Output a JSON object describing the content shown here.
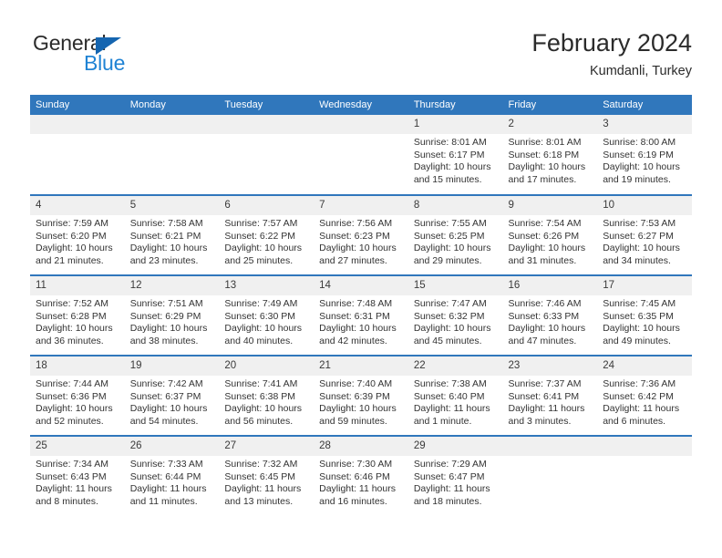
{
  "logo": {
    "text_top": "General",
    "text_bottom": "Blue",
    "triangle_color": "#1565b0",
    "blue_color": "#2083d4"
  },
  "header": {
    "title": "February 2024",
    "subtitle": "Kumdanli, Turkey"
  },
  "theme": {
    "header_blue": "#3077bc",
    "day_band_gray": "#f0f0f0",
    "text_dark": "#2b2b2b"
  },
  "calendar": {
    "weekday_headers": [
      "Sunday",
      "Monday",
      "Tuesday",
      "Wednesday",
      "Thursday",
      "Friday",
      "Saturday"
    ],
    "weeks": [
      [
        {
          "day": "",
          "sunrise": "",
          "sunset": "",
          "daylight": ""
        },
        {
          "day": "",
          "sunrise": "",
          "sunset": "",
          "daylight": ""
        },
        {
          "day": "",
          "sunrise": "",
          "sunset": "",
          "daylight": ""
        },
        {
          "day": "",
          "sunrise": "",
          "sunset": "",
          "daylight": ""
        },
        {
          "day": "1",
          "sunrise": "Sunrise: 8:01 AM",
          "sunset": "Sunset: 6:17 PM",
          "daylight": "Daylight: 10 hours and 15 minutes."
        },
        {
          "day": "2",
          "sunrise": "Sunrise: 8:01 AM",
          "sunset": "Sunset: 6:18 PM",
          "daylight": "Daylight: 10 hours and 17 minutes."
        },
        {
          "day": "3",
          "sunrise": "Sunrise: 8:00 AM",
          "sunset": "Sunset: 6:19 PM",
          "daylight": "Daylight: 10 hours and 19 minutes."
        }
      ],
      [
        {
          "day": "4",
          "sunrise": "Sunrise: 7:59 AM",
          "sunset": "Sunset: 6:20 PM",
          "daylight": "Daylight: 10 hours and 21 minutes."
        },
        {
          "day": "5",
          "sunrise": "Sunrise: 7:58 AM",
          "sunset": "Sunset: 6:21 PM",
          "daylight": "Daylight: 10 hours and 23 minutes."
        },
        {
          "day": "6",
          "sunrise": "Sunrise: 7:57 AM",
          "sunset": "Sunset: 6:22 PM",
          "daylight": "Daylight: 10 hours and 25 minutes."
        },
        {
          "day": "7",
          "sunrise": "Sunrise: 7:56 AM",
          "sunset": "Sunset: 6:23 PM",
          "daylight": "Daylight: 10 hours and 27 minutes."
        },
        {
          "day": "8",
          "sunrise": "Sunrise: 7:55 AM",
          "sunset": "Sunset: 6:25 PM",
          "daylight": "Daylight: 10 hours and 29 minutes."
        },
        {
          "day": "9",
          "sunrise": "Sunrise: 7:54 AM",
          "sunset": "Sunset: 6:26 PM",
          "daylight": "Daylight: 10 hours and 31 minutes."
        },
        {
          "day": "10",
          "sunrise": "Sunrise: 7:53 AM",
          "sunset": "Sunset: 6:27 PM",
          "daylight": "Daylight: 10 hours and 34 minutes."
        }
      ],
      [
        {
          "day": "11",
          "sunrise": "Sunrise: 7:52 AM",
          "sunset": "Sunset: 6:28 PM",
          "daylight": "Daylight: 10 hours and 36 minutes."
        },
        {
          "day": "12",
          "sunrise": "Sunrise: 7:51 AM",
          "sunset": "Sunset: 6:29 PM",
          "daylight": "Daylight: 10 hours and 38 minutes."
        },
        {
          "day": "13",
          "sunrise": "Sunrise: 7:49 AM",
          "sunset": "Sunset: 6:30 PM",
          "daylight": "Daylight: 10 hours and 40 minutes."
        },
        {
          "day": "14",
          "sunrise": "Sunrise: 7:48 AM",
          "sunset": "Sunset: 6:31 PM",
          "daylight": "Daylight: 10 hours and 42 minutes."
        },
        {
          "day": "15",
          "sunrise": "Sunrise: 7:47 AM",
          "sunset": "Sunset: 6:32 PM",
          "daylight": "Daylight: 10 hours and 45 minutes."
        },
        {
          "day": "16",
          "sunrise": "Sunrise: 7:46 AM",
          "sunset": "Sunset: 6:33 PM",
          "daylight": "Daylight: 10 hours and 47 minutes."
        },
        {
          "day": "17",
          "sunrise": "Sunrise: 7:45 AM",
          "sunset": "Sunset: 6:35 PM",
          "daylight": "Daylight: 10 hours and 49 minutes."
        }
      ],
      [
        {
          "day": "18",
          "sunrise": "Sunrise: 7:44 AM",
          "sunset": "Sunset: 6:36 PM",
          "daylight": "Daylight: 10 hours and 52 minutes."
        },
        {
          "day": "19",
          "sunrise": "Sunrise: 7:42 AM",
          "sunset": "Sunset: 6:37 PM",
          "daylight": "Daylight: 10 hours and 54 minutes."
        },
        {
          "day": "20",
          "sunrise": "Sunrise: 7:41 AM",
          "sunset": "Sunset: 6:38 PM",
          "daylight": "Daylight: 10 hours and 56 minutes."
        },
        {
          "day": "21",
          "sunrise": "Sunrise: 7:40 AM",
          "sunset": "Sunset: 6:39 PM",
          "daylight": "Daylight: 10 hours and 59 minutes."
        },
        {
          "day": "22",
          "sunrise": "Sunrise: 7:38 AM",
          "sunset": "Sunset: 6:40 PM",
          "daylight": "Daylight: 11 hours and 1 minute."
        },
        {
          "day": "23",
          "sunrise": "Sunrise: 7:37 AM",
          "sunset": "Sunset: 6:41 PM",
          "daylight": "Daylight: 11 hours and 3 minutes."
        },
        {
          "day": "24",
          "sunrise": "Sunrise: 7:36 AM",
          "sunset": "Sunset: 6:42 PM",
          "daylight": "Daylight: 11 hours and 6 minutes."
        }
      ],
      [
        {
          "day": "25",
          "sunrise": "Sunrise: 7:34 AM",
          "sunset": "Sunset: 6:43 PM",
          "daylight": "Daylight: 11 hours and 8 minutes."
        },
        {
          "day": "26",
          "sunrise": "Sunrise: 7:33 AM",
          "sunset": "Sunset: 6:44 PM",
          "daylight": "Daylight: 11 hours and 11 minutes."
        },
        {
          "day": "27",
          "sunrise": "Sunrise: 7:32 AM",
          "sunset": "Sunset: 6:45 PM",
          "daylight": "Daylight: 11 hours and 13 minutes."
        },
        {
          "day": "28",
          "sunrise": "Sunrise: 7:30 AM",
          "sunset": "Sunset: 6:46 PM",
          "daylight": "Daylight: 11 hours and 16 minutes."
        },
        {
          "day": "29",
          "sunrise": "Sunrise: 7:29 AM",
          "sunset": "Sunset: 6:47 PM",
          "daylight": "Daylight: 11 hours and 18 minutes."
        },
        {
          "day": "",
          "sunrise": "",
          "sunset": "",
          "daylight": ""
        },
        {
          "day": "",
          "sunrise": "",
          "sunset": "",
          "daylight": ""
        }
      ]
    ]
  }
}
